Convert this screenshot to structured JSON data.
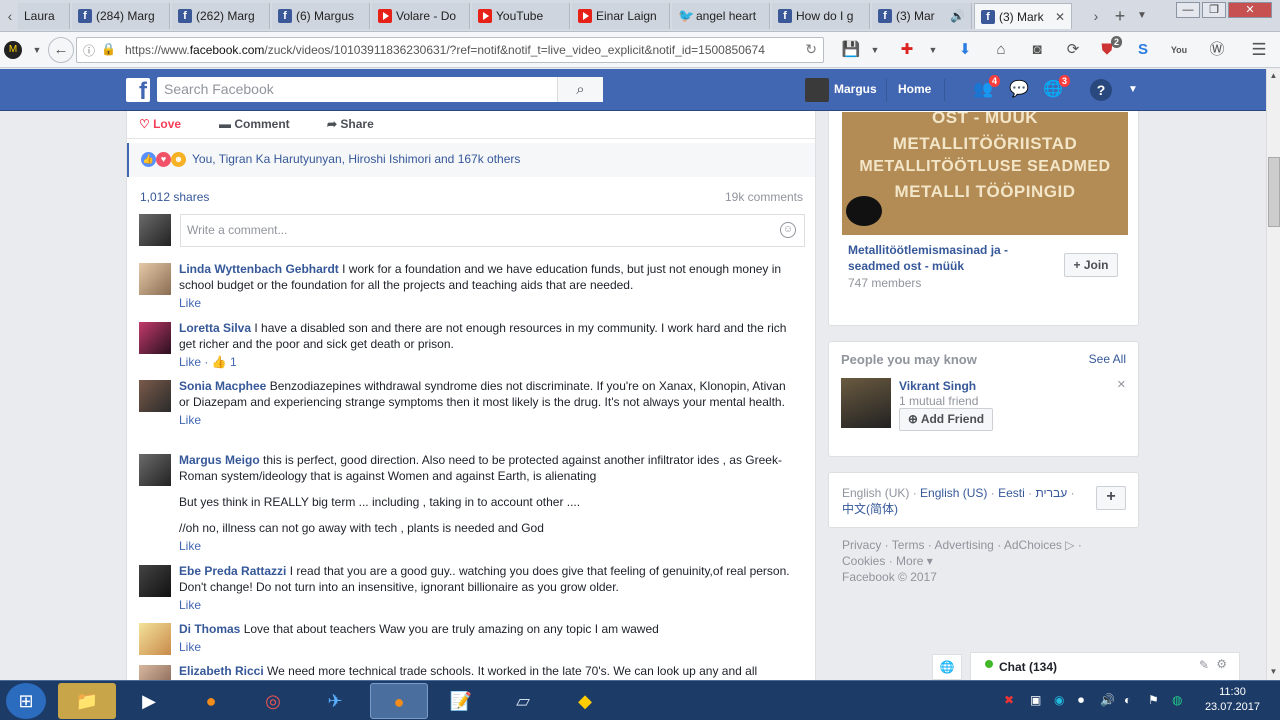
{
  "browser": {
    "tabs": [
      {
        "title": "Laura",
        "icon": "none"
      },
      {
        "title": "(284) Marg",
        "icon": "facebook-icon"
      },
      {
        "title": "(262) Marg",
        "icon": "facebook-icon"
      },
      {
        "title": "(6) Margus",
        "icon": "facebook-icon"
      },
      {
        "title": "Volare - Do",
        "icon": "youtube-icon"
      },
      {
        "title": "YouTube",
        "icon": "youtube-icon"
      },
      {
        "title": "Einar Laign",
        "icon": "youtube-icon"
      },
      {
        "title": "angel heart",
        "icon": "twitter-icon"
      },
      {
        "title": "How do I g",
        "icon": "facebook-icon"
      },
      {
        "title": "(3) Mar",
        "icon": "facebook-icon"
      },
      {
        "title": "(3) Mark",
        "icon": "facebook-icon"
      }
    ],
    "url_prefix": "https://www.",
    "url_domain": "facebook.com",
    "url_rest": "/zuck/videos/10103911836230631/?ref=notif&notif_t=live_video_explicit&notif_id=1500850674",
    "addon_badge": "2"
  },
  "fb": {
    "search_placeholder": "Search Facebook",
    "user_name": "Margus",
    "home": "Home",
    "friend_requests_badge": "4",
    "notifications_badge": "3"
  },
  "post": {
    "actions": {
      "love": "Love",
      "comment": "Comment",
      "share": "Share"
    },
    "reactions_text": "You, Tigran Ka Harutyunyan, Hiroshi Ishimori and 167k others",
    "shares": "1,012 shares",
    "comments_count": "19k comments",
    "write_placeholder": "Write a comment..."
  },
  "comments": [
    {
      "name": "Linda Wyttenbach Gebhardt",
      "text": "I work for a foundation and we have education funds, but just not enough money in school budget or the foundation for all the projects and teaching aids that are needed.",
      "like": "Like"
    },
    {
      "name": "Loretta Silva",
      "text": "I have a disabled son and there are not enough resources in my community. I work hard and the rich get richer and the poor and sick get death or prison.",
      "like": "Like",
      "like_count": "1"
    },
    {
      "name": "Sonia Macphee",
      "text": "Benzodiazepines withdrawal syndrome dies not discriminate. If you're on Xanax, Klonopin, Ativan or Diazepam and experiencing strange symptoms then it most likely is the drug. It's not always your mental health.",
      "like": "Like"
    },
    {
      "name": "Margus Meigo",
      "text": "this is perfect, good direction. Also need to be protected against another infiltrator ides , as Greek-Roman system/ideology that is against Women and against Earth, is alienating",
      "extra1": "But yes think in REALLY big term ... including , taking in to account other ....",
      "extra2": "//oh no, illness can not go away with tech , plants is needed and God",
      "like": "Like"
    },
    {
      "name": "Ebe Preda Rattazzi",
      "text": "I read that you are a good guy.. watching you does give that feeling of genuinity,of real person. Don't change! Do not turn into an insensitive, ignorant billionaire as you grow older.",
      "like": "Like"
    },
    {
      "name": "Di Thomas",
      "text": "Love that about teachers Waw you are truly amazing on any topic I am wawed",
      "like": "Like"
    },
    {
      "name": "Elizabeth Ricci",
      "text": "We need more technical trade schools. It worked in the late 70's. We can look up any and all",
      "like": ""
    }
  ],
  "sidebar": {
    "group_image_lines": [
      "OST - MÜÜK",
      "METALLITÖÖRIISTAD",
      "METALLITÖÖTLUSE SEADMED",
      "METALLI TÖÖPINGID"
    ],
    "group_name": "Metallitöötlemismasinad ja -seadmed ost - müük",
    "group_members": "747 members",
    "join": "+ Join",
    "pymk_title": "People you may know",
    "see_all": "See All",
    "person_name": "Vikrant Singh",
    "mutual": "1 mutual friend",
    "add_friend": "Add Friend",
    "languages": [
      "English (UK)",
      "English (US)",
      "Eesti",
      "עברית",
      "中文(简体)"
    ],
    "footer_links": [
      "Privacy",
      "Terms",
      "Advertising",
      "AdChoices",
      "Cookies",
      "More"
    ],
    "copyright": "Facebook © 2017"
  },
  "chat": {
    "label": "Chat (134)"
  },
  "taskbar": {
    "time": "11:30",
    "date": "23.07.2017"
  }
}
